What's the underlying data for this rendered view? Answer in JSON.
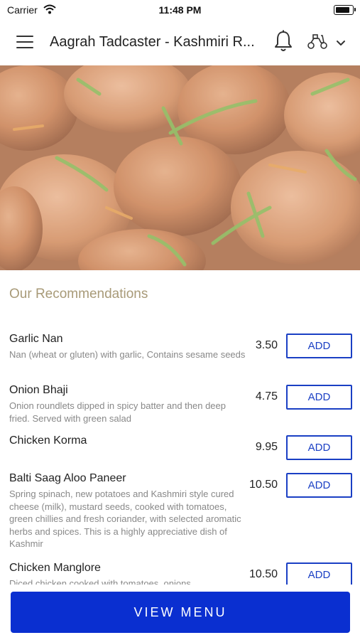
{
  "status_bar": {
    "carrier": "Carrier",
    "time": "11:48 PM",
    "battery_level": 0.8
  },
  "header": {
    "title": "Aagrah Tadcaster - Kashmiri R...",
    "icons": [
      "hamburger-menu-icon",
      "bell-icon",
      "scooter-icon",
      "chevron-down-icon"
    ]
  },
  "section": {
    "title": "Our Recommendations"
  },
  "items": [
    {
      "name": "Garlic Nan",
      "description": "Nan (wheat or gluten) with garlic, Contains sesame seeds",
      "price": "3.50",
      "add_label": "ADD"
    },
    {
      "name": "Onion Bhaji",
      "description": "Onion roundlets dipped in spicy batter and then deep fried. Served with green salad",
      "price": "4.75",
      "add_label": "ADD"
    },
    {
      "name": "Chicken Korma",
      "description": "",
      "price": "9.95",
      "add_label": "ADD"
    },
    {
      "name": "Balti Saag Aloo Paneer",
      "description": "Spring spinach, new potatoes and Kashmiri style cured cheese (milk), mustard seeds, cooked with tomatoes, green chillies and fresh coriander, with selected aromatic herbs and spices. This is a highly appreciative dish of Kashmir",
      "price": "10.50",
      "add_label": "ADD"
    },
    {
      "name": "Chicken Manglore",
      "description": "Diced chicken cooked with tomatoes, onions",
      "price": "10.50",
      "add_label": "ADD"
    }
  ],
  "cta": {
    "label": "VIEW MENU"
  },
  "colors": {
    "accent": "#0a2fd0",
    "button_border": "#1a3fc4",
    "section_title": "#a89a78"
  }
}
